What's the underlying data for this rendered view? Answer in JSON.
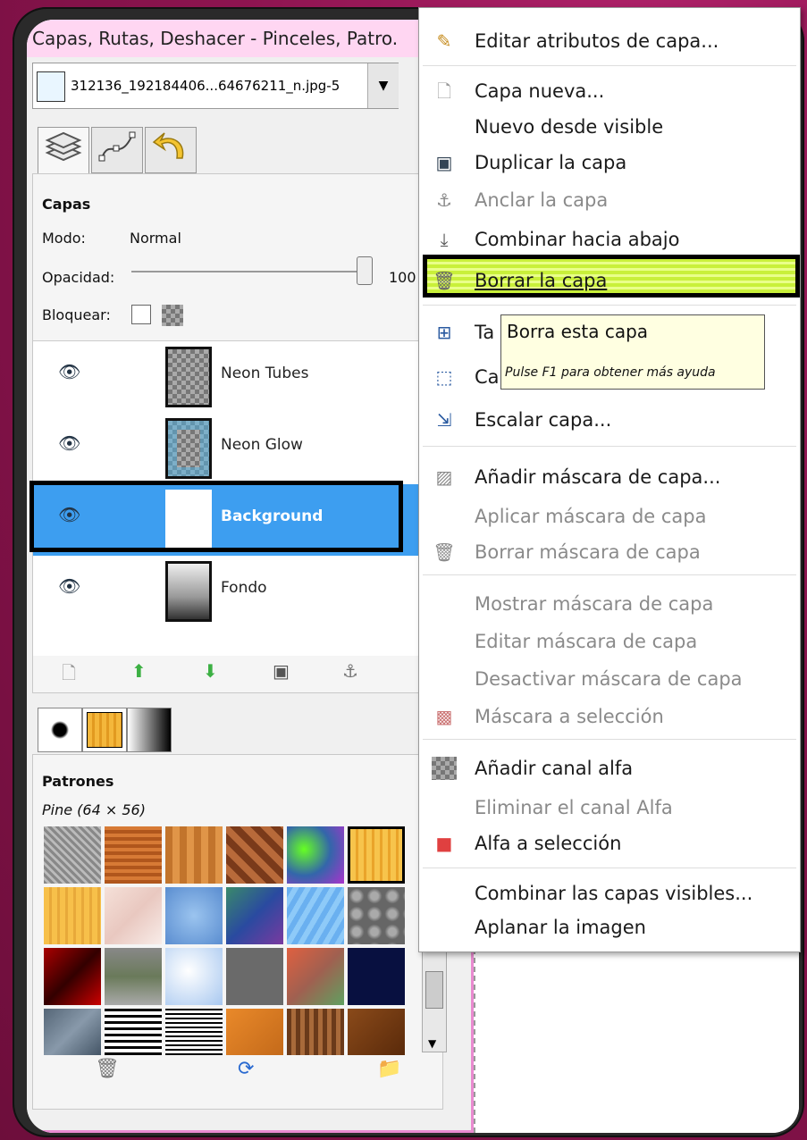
{
  "dock": {
    "title": "Capas, Rutas, Deshacer - Pinceles, Patro.",
    "image_combo": "312136_192184406...64676211_n.jpg-5",
    "tabs": [
      "layers-icon",
      "paths-icon",
      "undo-icon"
    ]
  },
  "layers": {
    "heading": "Capas",
    "mode_label": "Modo:",
    "mode_value": "Normal",
    "opacity_label": "Opacidad:",
    "opacity_value": "100",
    "lock_label": "Bloquear:",
    "items": [
      {
        "name": "Neon Tubes"
      },
      {
        "name": "Neon Glow"
      },
      {
        "name": "Background"
      },
      {
        "name": "Fondo"
      }
    ]
  },
  "patterns": {
    "heading": "Patrones",
    "selected": "Pine (64 × 56)"
  },
  "menu": {
    "items": [
      {
        "label": "Editar atributos de capa...",
        "icon": "edit-icon",
        "disabled": false
      },
      {
        "label": "Capa nueva...",
        "icon": "new-layer-icon",
        "disabled": false
      },
      {
        "label": "Nuevo desde visible",
        "icon": "",
        "disabled": false
      },
      {
        "label": "Duplicar la capa",
        "icon": "duplicate-icon",
        "disabled": false
      },
      {
        "label": "Anclar la capa",
        "icon": "anchor-icon",
        "disabled": true
      },
      {
        "label": "Combinar hacia abajo",
        "icon": "merge-down-icon",
        "disabled": false
      },
      {
        "label": "Borrar la capa",
        "icon": "trash-icon",
        "disabled": false
      },
      {
        "label": "Ta",
        "icon": "layer-size-icon",
        "disabled": false
      },
      {
        "label": "Ca",
        "icon": "layer-to-image-size-icon",
        "disabled": false
      },
      {
        "label": "Escalar capa...",
        "icon": "scale-icon",
        "disabled": false
      },
      {
        "label": "Añadir máscara de capa...",
        "icon": "add-mask-icon",
        "disabled": false
      },
      {
        "label": "Aplicar máscara de capa",
        "icon": "",
        "disabled": true
      },
      {
        "label": "Borrar máscara de capa",
        "icon": "trash-icon",
        "disabled": true
      },
      {
        "label": "Mostrar máscara de capa",
        "icon": "",
        "disabled": true
      },
      {
        "label": "Editar máscara de capa",
        "icon": "",
        "disabled": true
      },
      {
        "label": "Desactivar máscara de capa",
        "icon": "",
        "disabled": true
      },
      {
        "label": "Máscara a selección",
        "icon": "mask-to-selection-icon",
        "disabled": true
      },
      {
        "label": "Añadir canal alfa",
        "icon": "alpha-icon",
        "disabled": false
      },
      {
        "label": "Eliminar el canal Alfa",
        "icon": "",
        "disabled": true
      },
      {
        "label": "Alfa a selección",
        "icon": "alpha-to-selection-icon",
        "disabled": false
      },
      {
        "label": "Combinar las capas visibles...",
        "icon": "",
        "disabled": false
      },
      {
        "label": "Aplanar la imagen",
        "icon": "",
        "disabled": false
      }
    ]
  },
  "tooltip": {
    "title": "Borra esta capa",
    "help": "Pulse F1 para obtener más ayuda"
  },
  "colors": {
    "selection": "#3d9ef0",
    "highlight": "#c9f03a",
    "background": "#8e1450"
  }
}
